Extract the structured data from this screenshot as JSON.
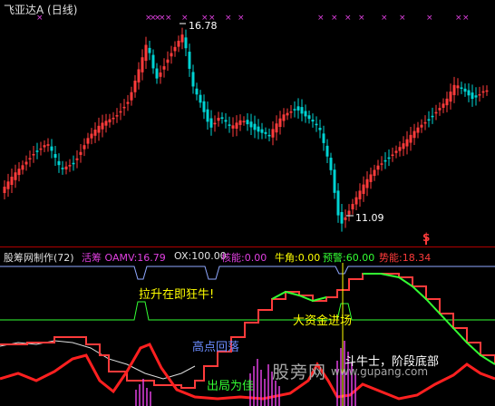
{
  "header": {
    "title": "飞亚达A (日线)"
  },
  "price_chart": {
    "marks": {
      "high": "16.78",
      "low": "11.09",
      "signal": "$"
    },
    "colors": {
      "up": "#ff3b3b",
      "down": "#00d4d4",
      "marker": "#e040e0"
    }
  },
  "indicator": {
    "name": "股筹网制作(72)",
    "fields": [
      {
        "text": "活筹 OAMV:16.79",
        "color": "#e040e0"
      },
      {
        "text": "OX:100.00",
        "color": "#e0e0e0"
      },
      {
        "text": "核能:0.00",
        "color": "#e040e0"
      },
      {
        "text": "牛角:0.00",
        "color": "#ffff00"
      },
      {
        "text": "预警:60.00",
        "color": "#33ff33"
      },
      {
        "text": "势能:18.34",
        "color": "#ff3b3b"
      }
    ],
    "annotations": {
      "rise": "拉升在即狂牛!",
      "big_money": "大资金进场",
      "high_fall": "高点回落",
      "exit": "出局为佳",
      "bull_fighter": "斗牛士，阶段底部"
    }
  },
  "watermark": {
    "text": "股旁网",
    "url": "www.gupang.com"
  }
}
